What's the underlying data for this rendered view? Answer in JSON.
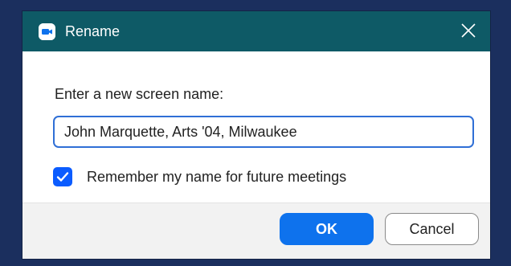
{
  "window": {
    "title": "Rename",
    "app_icon": "zoom-camera-icon",
    "close_icon": "close-icon",
    "titlebar_color": "#0e5a66",
    "desktop_color": "#1b2f5e"
  },
  "form": {
    "prompt": "Enter a new screen name:",
    "name_value": "John Marquette, Arts '04, Milwaukee",
    "remember_checked": true,
    "remember_label": "Remember my name for future meetings"
  },
  "buttons": {
    "ok_label": "OK",
    "cancel_label": "Cancel",
    "primary_color": "#0e72ed"
  }
}
